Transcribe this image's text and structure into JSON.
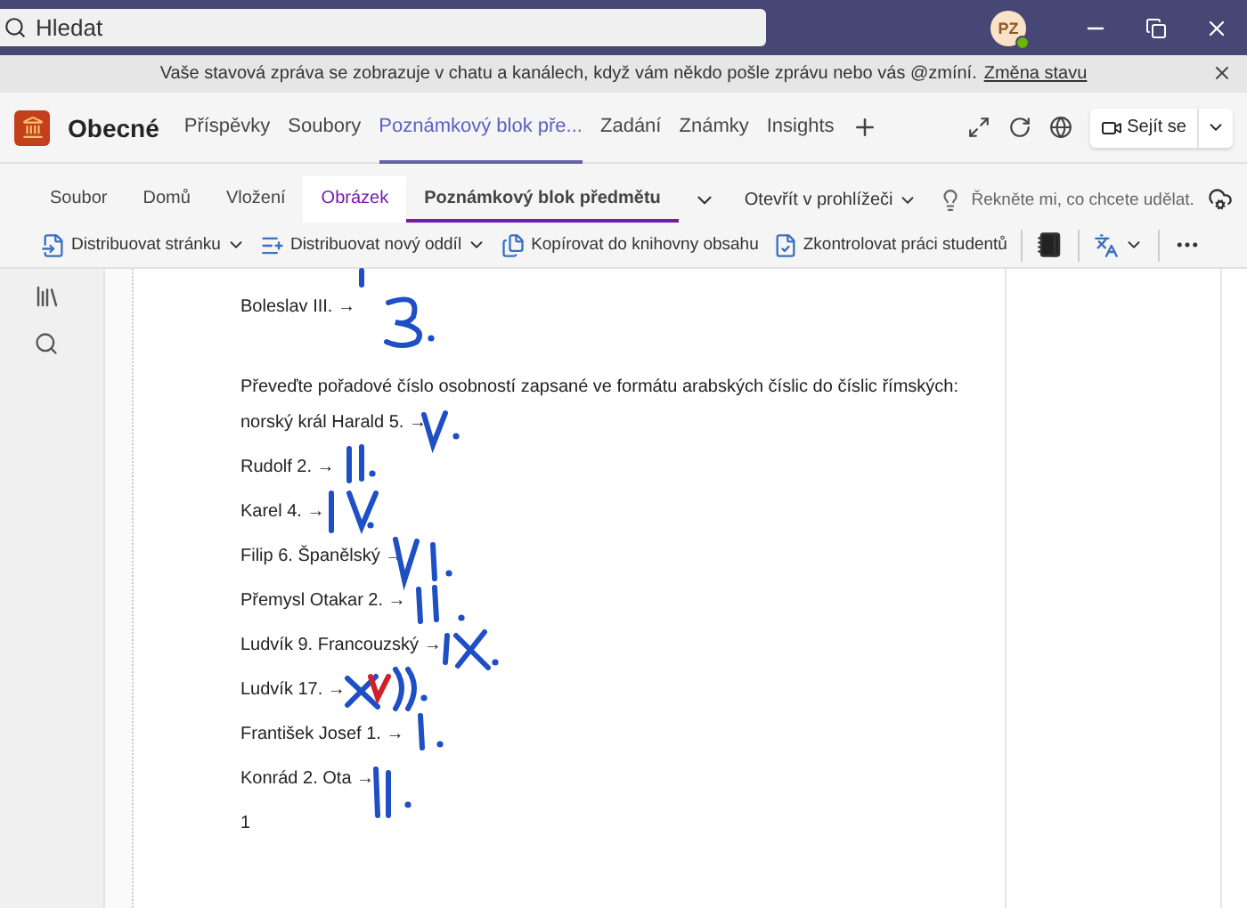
{
  "title_bar": {
    "search": {
      "placeholder": "Hledat"
    },
    "avatar": {
      "initials": "PZ"
    }
  },
  "notification": {
    "text": "Vaše stavová zpráva se zobrazuje v chatu a kanálech, když vám někdo pošle zprávu nebo vás @zmíní.",
    "link": "Změna stavu"
  },
  "channel": {
    "name": "Obecné",
    "tabs": [
      {
        "label": "Příspěvky",
        "selected": false
      },
      {
        "label": "Soubory",
        "selected": false
      },
      {
        "label": "Poznámkový blok pře...",
        "selected": true
      },
      {
        "label": "Zadání",
        "selected": false
      },
      {
        "label": "Známky",
        "selected": false
      },
      {
        "label": "Insights",
        "selected": false
      }
    ],
    "meet_button": "Sejít se"
  },
  "ribbon": {
    "tabs": [
      {
        "label": "Soubor",
        "selected": false,
        "contextual": false
      },
      {
        "label": "Domů",
        "selected": false,
        "contextual": false
      },
      {
        "label": "Vložení",
        "selected": false,
        "contextual": false
      },
      {
        "label": "Obrázek",
        "selected": false,
        "contextual": true
      },
      {
        "label": "Poznámkový blok předmětu",
        "selected": true,
        "contextual": false
      }
    ],
    "open_in_browser": "Otevřít v prohlížeči",
    "tell_me": {
      "placeholder": "Řekněte mi, co chcete udělat."
    }
  },
  "toolbar": [
    {
      "kind": "distribute-page",
      "label": "Distribuovat stránku",
      "dropdown": true
    },
    {
      "kind": "distribute-section",
      "label": "Distribuovat nový oddíl",
      "dropdown": true
    },
    {
      "kind": "copy",
      "label": "Kopírovat do knihovny obsahu",
      "dropdown": false
    },
    {
      "kind": "review",
      "label": "Zkontrolovat práci studentů",
      "dropdown": false
    }
  ],
  "page": {
    "lines": [
      {
        "kind": "item",
        "text": "Boleslav III. →"
      },
      {
        "kind": "instruction",
        "text": "Převeďte pořadové číslo osobností zapsané ve formátu arabských číslic do číslic římských:"
      },
      {
        "kind": "item",
        "text": "norský král Harald 5. →"
      },
      {
        "kind": "item",
        "text": "Rudolf 2. →"
      },
      {
        "kind": "item",
        "text": "Karel 4. →"
      },
      {
        "kind": "item",
        "text": "Filip 6. Španělský →"
      },
      {
        "kind": "item",
        "text": "Přemysl Otakar 2. →"
      },
      {
        "kind": "item",
        "text": "Ludvík 9. Francouzský →"
      },
      {
        "kind": "item",
        "text": "Ludvík 17. →"
      },
      {
        "kind": "item",
        "text": "František Josef 1. →"
      },
      {
        "kind": "item",
        "text": "Konrád 2. Ota →"
      },
      {
        "kind": "footnote",
        "text": "1"
      }
    ]
  }
}
